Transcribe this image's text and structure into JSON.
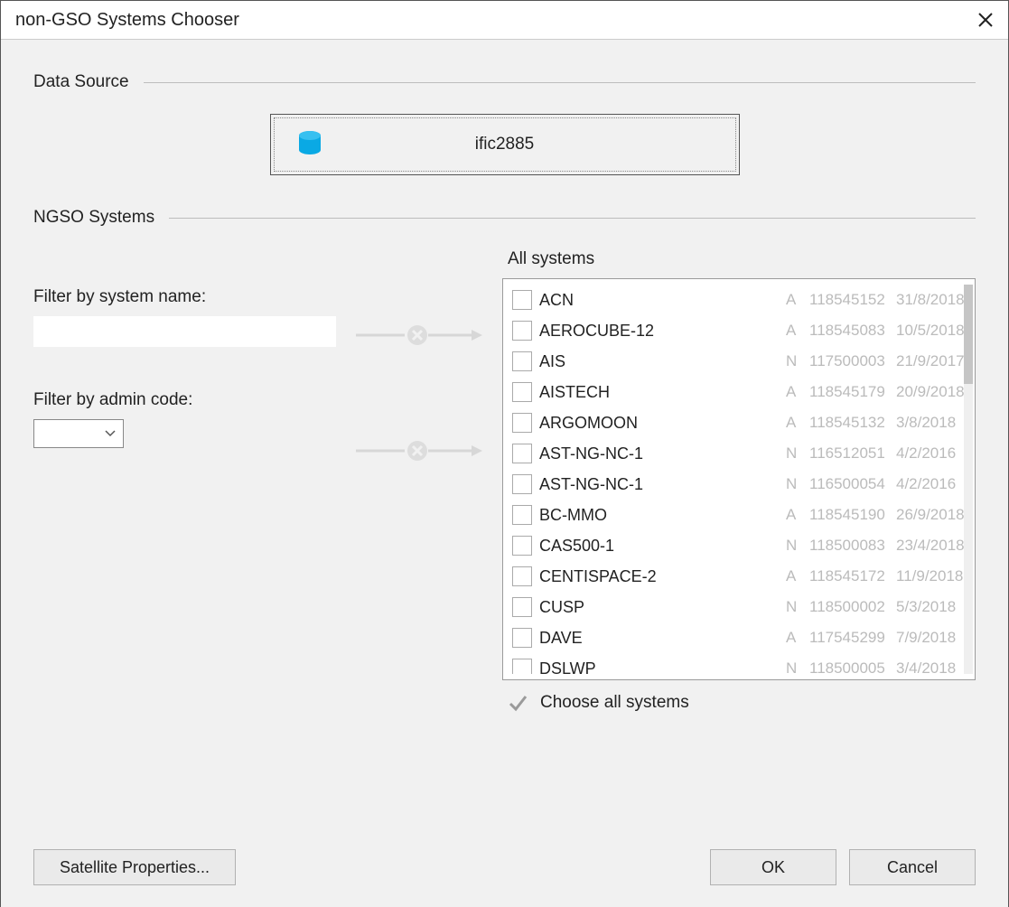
{
  "title": "non-GSO Systems Chooser",
  "sections": {
    "data_source": "Data Source",
    "ngso": "NGSO Systems"
  },
  "data_source_value": "ific2885",
  "filters": {
    "name_label": "Filter by system name:",
    "name_value": "",
    "admin_label": "Filter by admin code:",
    "admin_value": ""
  },
  "systems_label": "All systems",
  "choose_all_label": "Choose all systems",
  "buttons": {
    "sat": "Satellite Properties...",
    "ok": "OK",
    "cancel": "Cancel"
  },
  "systems": [
    {
      "name": "ACN",
      "code": "A",
      "id": "118545152",
      "date": "31/8/2018"
    },
    {
      "name": "AEROCUBE-12",
      "code": "A",
      "id": "118545083",
      "date": "10/5/2018"
    },
    {
      "name": "AIS",
      "code": "N",
      "id": "117500003",
      "date": "21/9/2017"
    },
    {
      "name": "AISTECH",
      "code": "A",
      "id": "118545179",
      "date": "20/9/2018"
    },
    {
      "name": "ARGOMOON",
      "code": "A",
      "id": "118545132",
      "date": "3/8/2018"
    },
    {
      "name": "AST-NG-NC-1",
      "code": "N",
      "id": "116512051",
      "date": "4/2/2016"
    },
    {
      "name": "AST-NG-NC-1",
      "code": "N",
      "id": "116500054",
      "date": "4/2/2016"
    },
    {
      "name": "BC-MMO",
      "code": "A",
      "id": "118545190",
      "date": "26/9/2018"
    },
    {
      "name": "CAS500-1",
      "code": "N",
      "id": "118500083",
      "date": "23/4/2018"
    },
    {
      "name": "CENTISPACE-2",
      "code": "A",
      "id": "118545172",
      "date": "11/9/2018"
    },
    {
      "name": "CUSP",
      "code": "N",
      "id": "118500002",
      "date": "5/3/2018"
    },
    {
      "name": "DAVE",
      "code": "A",
      "id": "117545299",
      "date": "7/9/2018"
    },
    {
      "name": "DSLWP",
      "code": "N",
      "id": "118500005",
      "date": "3/4/2018"
    }
  ]
}
